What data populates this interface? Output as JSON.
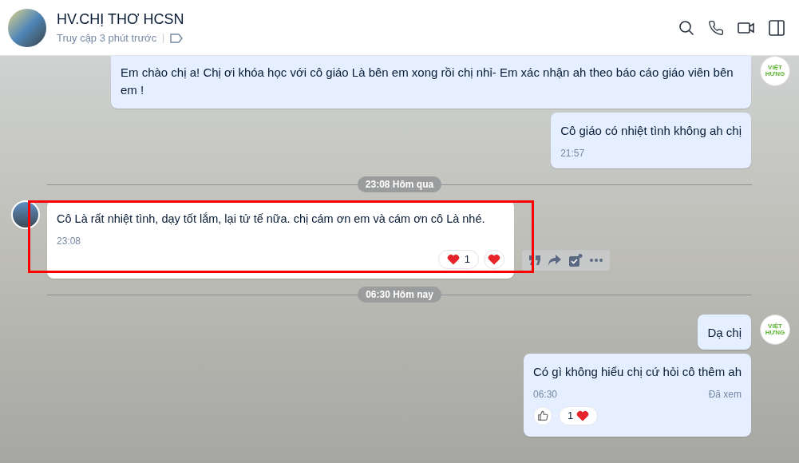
{
  "header": {
    "name": "HV.CHỊ THƠ HCSN",
    "status": "Truy cập 3 phút trước"
  },
  "messages": [
    {
      "kind": "outgoing",
      "text": "Em chào chị a! Chị ơi khóa học với cô giáo Là bên em xong rồi chị nhỉ- Em xác nhận ah theo báo cáo giáo viên bên em !",
      "avatar": "VIỆT HƯNG",
      "cut_top": true
    },
    {
      "kind": "outgoing",
      "text": "Cô giáo có nhiệt tình không ah chị",
      "time": "21:57"
    },
    {
      "kind": "divider",
      "text": "23:08 Hôm qua"
    },
    {
      "kind": "incoming",
      "text": "Cô Là rất nhiệt tình, dạy tốt lắm, lại tử tế nữa.  chị cám ơn em và cám ơn cô Là nhé.",
      "time": "23:08",
      "highlighted": true,
      "toolbar": true,
      "reactions": [
        {
          "kind": "heart_count",
          "count": "1"
        },
        {
          "kind": "heart"
        }
      ]
    },
    {
      "kind": "divider",
      "text": "06:30 Hôm nay"
    },
    {
      "kind": "outgoing",
      "text": "Dạ chị",
      "avatar": "VIỆT HƯNG"
    },
    {
      "kind": "outgoing",
      "text": "Có gì không hiểu chị cứ hỏi cô thêm ah",
      "time": "06:30",
      "seen": "Đã xem",
      "reactions": [
        {
          "kind": "like"
        },
        {
          "kind": "count_heart",
          "count": "1"
        }
      ]
    }
  ]
}
